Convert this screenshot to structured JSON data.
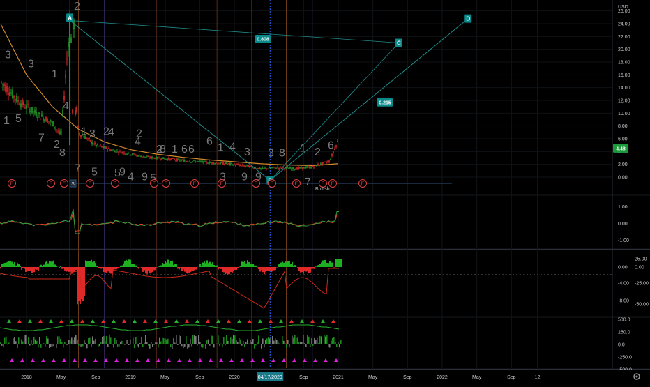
{
  "chart_data": [
    {
      "type": "line",
      "pane": "main",
      "currency": "USD",
      "last_price": "4.48",
      "y_ticks": [
        "26.00",
        "24.00",
        "22.00",
        "20.00",
        "18.00",
        "16.00",
        "14.00",
        "12.00",
        "10.00",
        "8.00",
        "6.00",
        "4.00",
        "2.00",
        "0.00"
      ],
      "ylim": [
        -1.0,
        26.0
      ],
      "x_ticks": [
        "2018",
        "May",
        "Sep",
        "2019",
        "May",
        "Sep",
        "2020",
        "04/17/2020",
        "Sep",
        "2021",
        "May",
        "Sep",
        "2022",
        "May",
        "Sep",
        "12"
      ],
      "crosshair_date": "04/17/2020",
      "series": [
        {
          "kind": "price",
          "x": [
            "2017-10",
            "2017-12",
            "2018-02",
            "2018-04",
            "2018-05",
            "2018-06",
            "2018-07",
            "2018-09",
            "2018-11",
            "2019-01",
            "2019-03",
            "2019-05",
            "2019-07",
            "2019-09",
            "2019-11",
            "2020-01",
            "2020-03",
            "2020-04",
            "2020-06",
            "2020-08",
            "2020-10",
            "2020-12",
            "2021-01"
          ],
          "y": [
            15,
            12,
            10,
            8.5,
            6.5,
            24.5,
            7,
            5,
            4.2,
            3.6,
            3.1,
            2.9,
            2.6,
            2.4,
            2.2,
            2.0,
            1.6,
            1.3,
            1.5,
            1.3,
            1.6,
            2.5,
            5.8
          ]
        },
        {
          "kind": "moving-average",
          "x": [
            "2017-10",
            "2018-01",
            "2018-04",
            "2018-07",
            "2018-10",
            "2019-01",
            "2019-04",
            "2019-07",
            "2019-10",
            "2020-01",
            "2020-04",
            "2020-07",
            "2020-10",
            "2021-01"
          ],
          "y": [
            24,
            16,
            11,
            7.5,
            5.5,
            4.3,
            3.6,
            3.1,
            2.7,
            2.4,
            2.1,
            1.9,
            1.8,
            2.1
          ]
        }
      ],
      "pattern_points": [
        {
          "label": "A",
          "date": "2018-06",
          "value": 24.5
        },
        {
          "label": "B",
          "date": "2020-04",
          "value": -0.5
        },
        {
          "label": "C",
          "date": "2021-08",
          "value": 21.0
        },
        {
          "label": "D",
          "date": "2022-04",
          "value": 24.8
        }
      ],
      "ratios": [
        "0.808",
        "0.215"
      ],
      "earnings_markers": [
        "E",
        "E",
        "E",
        "E",
        "E",
        "E",
        "E",
        "E",
        "E",
        "E",
        "E",
        "E",
        "E",
        "E",
        "E"
      ],
      "split_marker": "S",
      "annotation": "Bullish",
      "wave_numbers": [
        "2",
        "3",
        "1",
        "3",
        "4",
        "5",
        "1",
        "7",
        "2",
        "8",
        "3",
        "1",
        "2",
        "4",
        "2",
        "4",
        "7",
        "5",
        "5",
        "9",
        "4",
        "9",
        "5",
        "2",
        "8",
        "1",
        "6",
        "6",
        "6",
        "3",
        "9",
        "1",
        "4",
        "3",
        "9",
        "3",
        "8",
        "1",
        "2",
        "6",
        "7"
      ]
    },
    {
      "type": "line",
      "pane": "oscillator-1",
      "y_ticks": [
        "1.00",
        "0.00",
        "-1.00"
      ],
      "ylim": [
        -1.3,
        1.3
      ]
    },
    {
      "type": "bar",
      "pane": "oscillator-2",
      "right_ticks": [
        "25.00",
        "0.00",
        "-25.00",
        "-50.00"
      ],
      "left_ticks": [
        "0.00",
        "-4.00",
        "-8.00"
      ]
    },
    {
      "type": "line",
      "pane": "oscillator-3",
      "y_ticks": [
        "500.0",
        "250.0",
        "0.0",
        "-250.0",
        "-500.0"
      ]
    }
  ]
}
